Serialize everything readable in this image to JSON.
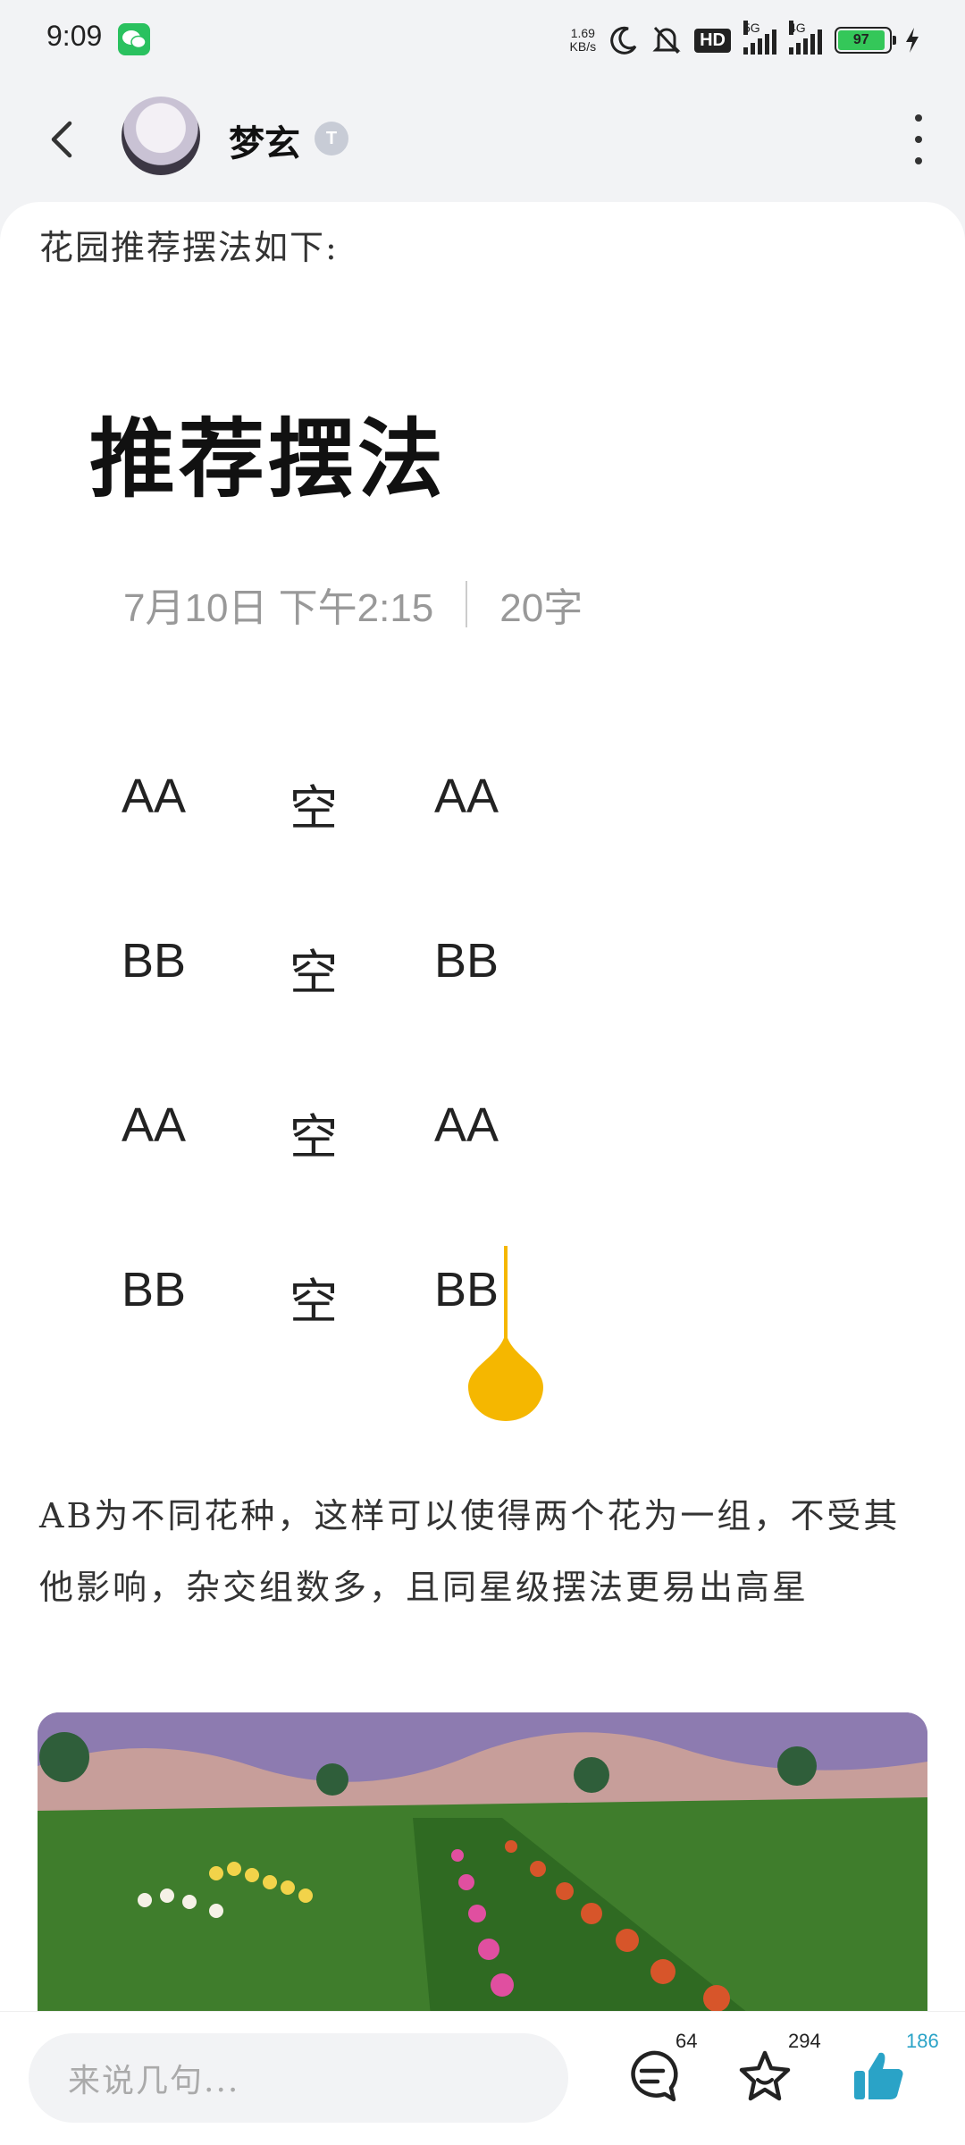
{
  "status_bar": {
    "time": "9:09",
    "net_speed_value": "1.69",
    "net_speed_unit": "KB/s",
    "hd_label": "HD",
    "sig1_label": "5G",
    "sig2_label": "4G",
    "battery_level": "97"
  },
  "header": {
    "username": "梦玄",
    "badge": "T"
  },
  "post": {
    "intro": "花园推荐摆法如下:",
    "note": {
      "title": "推荐摆法",
      "date": "7月10日 下午2:15",
      "word_count": "20字",
      "rows": [
        [
          "AA",
          "空",
          "AA"
        ],
        [
          "BB",
          "空",
          "BB"
        ],
        [
          "AA",
          "空",
          "AA"
        ],
        [
          "BB",
          "空",
          "BB"
        ]
      ]
    },
    "description": "AB为不同花种，这样可以使得两个花为一组，不受其他影响，杂交组数多，且同星级摆法更易出高星"
  },
  "bottom_bar": {
    "comment_placeholder": "来说几句...",
    "comment_count": "64",
    "favorite_count": "294",
    "like_count": "186"
  },
  "colors": {
    "accent_like": "#2aa3c7",
    "cursor": "#f5b700",
    "battery": "#34c759",
    "wechat": "#2ac15f"
  },
  "icons": [
    "wechat-icon",
    "moon-icon",
    "bell-off-icon",
    "signal-icon",
    "battery-icon",
    "back-arrow-icon",
    "more-vertical-icon",
    "comment-icon",
    "star-icon",
    "thumbs-up-icon"
  ]
}
